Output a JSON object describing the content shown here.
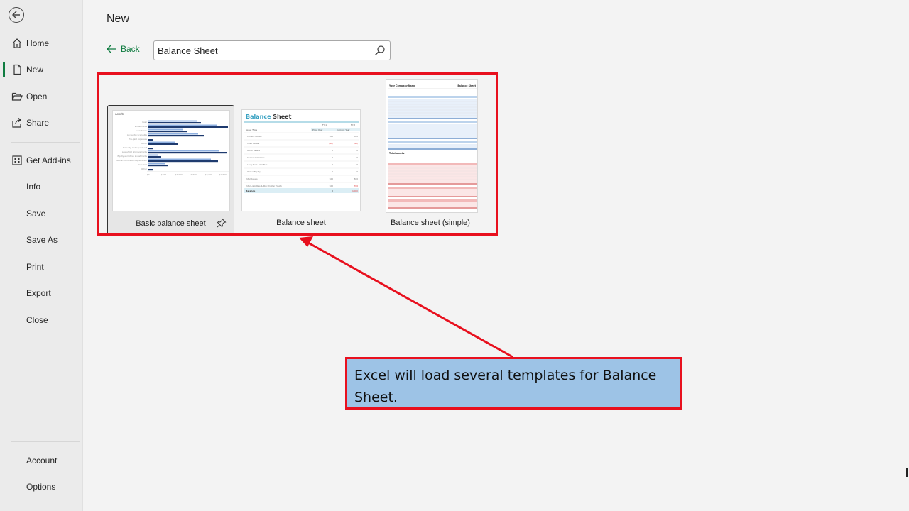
{
  "sidebar": {
    "items": [
      {
        "label": "Home",
        "icon": "home-icon"
      },
      {
        "label": "New",
        "icon": "new-file-icon",
        "active": true
      },
      {
        "label": "Open",
        "icon": "folder-open-icon"
      },
      {
        "label": "Share",
        "icon": "share-icon"
      },
      {
        "label": "Get Add-ins",
        "icon": "add-ins-icon"
      },
      {
        "label": "Info"
      },
      {
        "label": "Save"
      },
      {
        "label": "Save As"
      },
      {
        "label": "Print"
      },
      {
        "label": "Export"
      },
      {
        "label": "Close"
      },
      {
        "label": "Account"
      },
      {
        "label": "Options"
      }
    ]
  },
  "main": {
    "title": "New",
    "back_label": "Back",
    "search": {
      "value": "Balance Sheet"
    },
    "templates": [
      {
        "name": "Basic balance sheet",
        "selected": true
      },
      {
        "name": "Balance sheet"
      },
      {
        "name": "Balance sheet (simple)"
      }
    ]
  },
  "annotation": {
    "callout_text": "Excel will load several templates for Balance Sheet.",
    "border_color": "#e8101e",
    "fill_color": "#9dc3e6"
  },
  "colors": {
    "accent": "#107c41"
  }
}
